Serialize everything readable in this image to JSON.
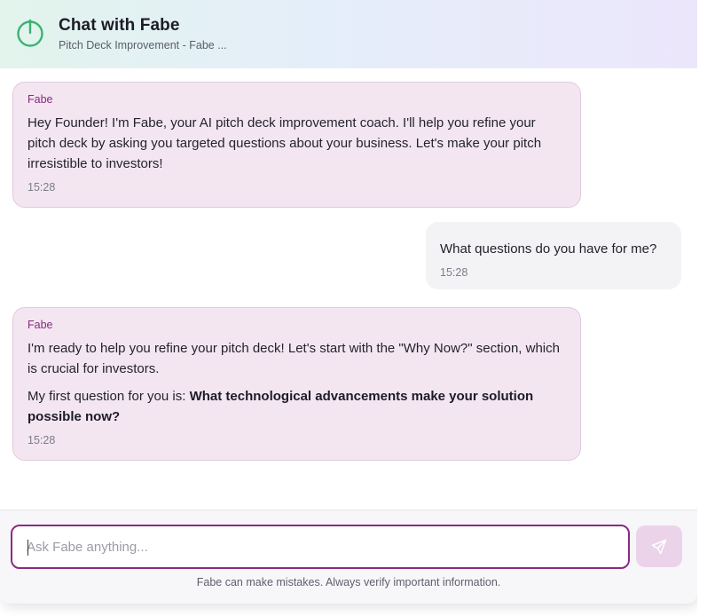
{
  "header": {
    "title": "Chat with Fabe",
    "subtitle": "Pitch Deck Improvement - Fabe ...",
    "icon": "power-icon",
    "accent": "#3bb273"
  },
  "messages": [
    {
      "role": "bot",
      "sender": "Fabe",
      "paragraphs": [
        "Hey Founder! I'm Fabe, your AI pitch deck improvement coach. I'll help you refine your pitch deck by asking you targeted questions about your business. Let's make your pitch irresistible to investors!"
      ],
      "time": "15:28"
    },
    {
      "role": "user",
      "text": "What questions do you have for me?",
      "time": "15:28"
    },
    {
      "role": "bot",
      "sender": "Fabe",
      "paragraph1": "I'm ready to help you refine your pitch deck! Let's start with the \"Why Now?\" section, which is crucial for investors.",
      "paragraph2_prefix": "My first question for you is: ",
      "paragraph2_bold": "What technological advancements make your solution possible now?",
      "time": "15:28"
    }
  ],
  "composer": {
    "placeholder": "Ask Fabe anything...",
    "value": "",
    "send_icon": "send-icon",
    "disclaimer": "Fabe can make mistakes. Always verify important information."
  },
  "colors": {
    "brand": "#8b2a83",
    "bot_bubble": "#f3e6f1",
    "user_bubble": "#f3f3f6",
    "send_button": "#ebd3ea"
  }
}
